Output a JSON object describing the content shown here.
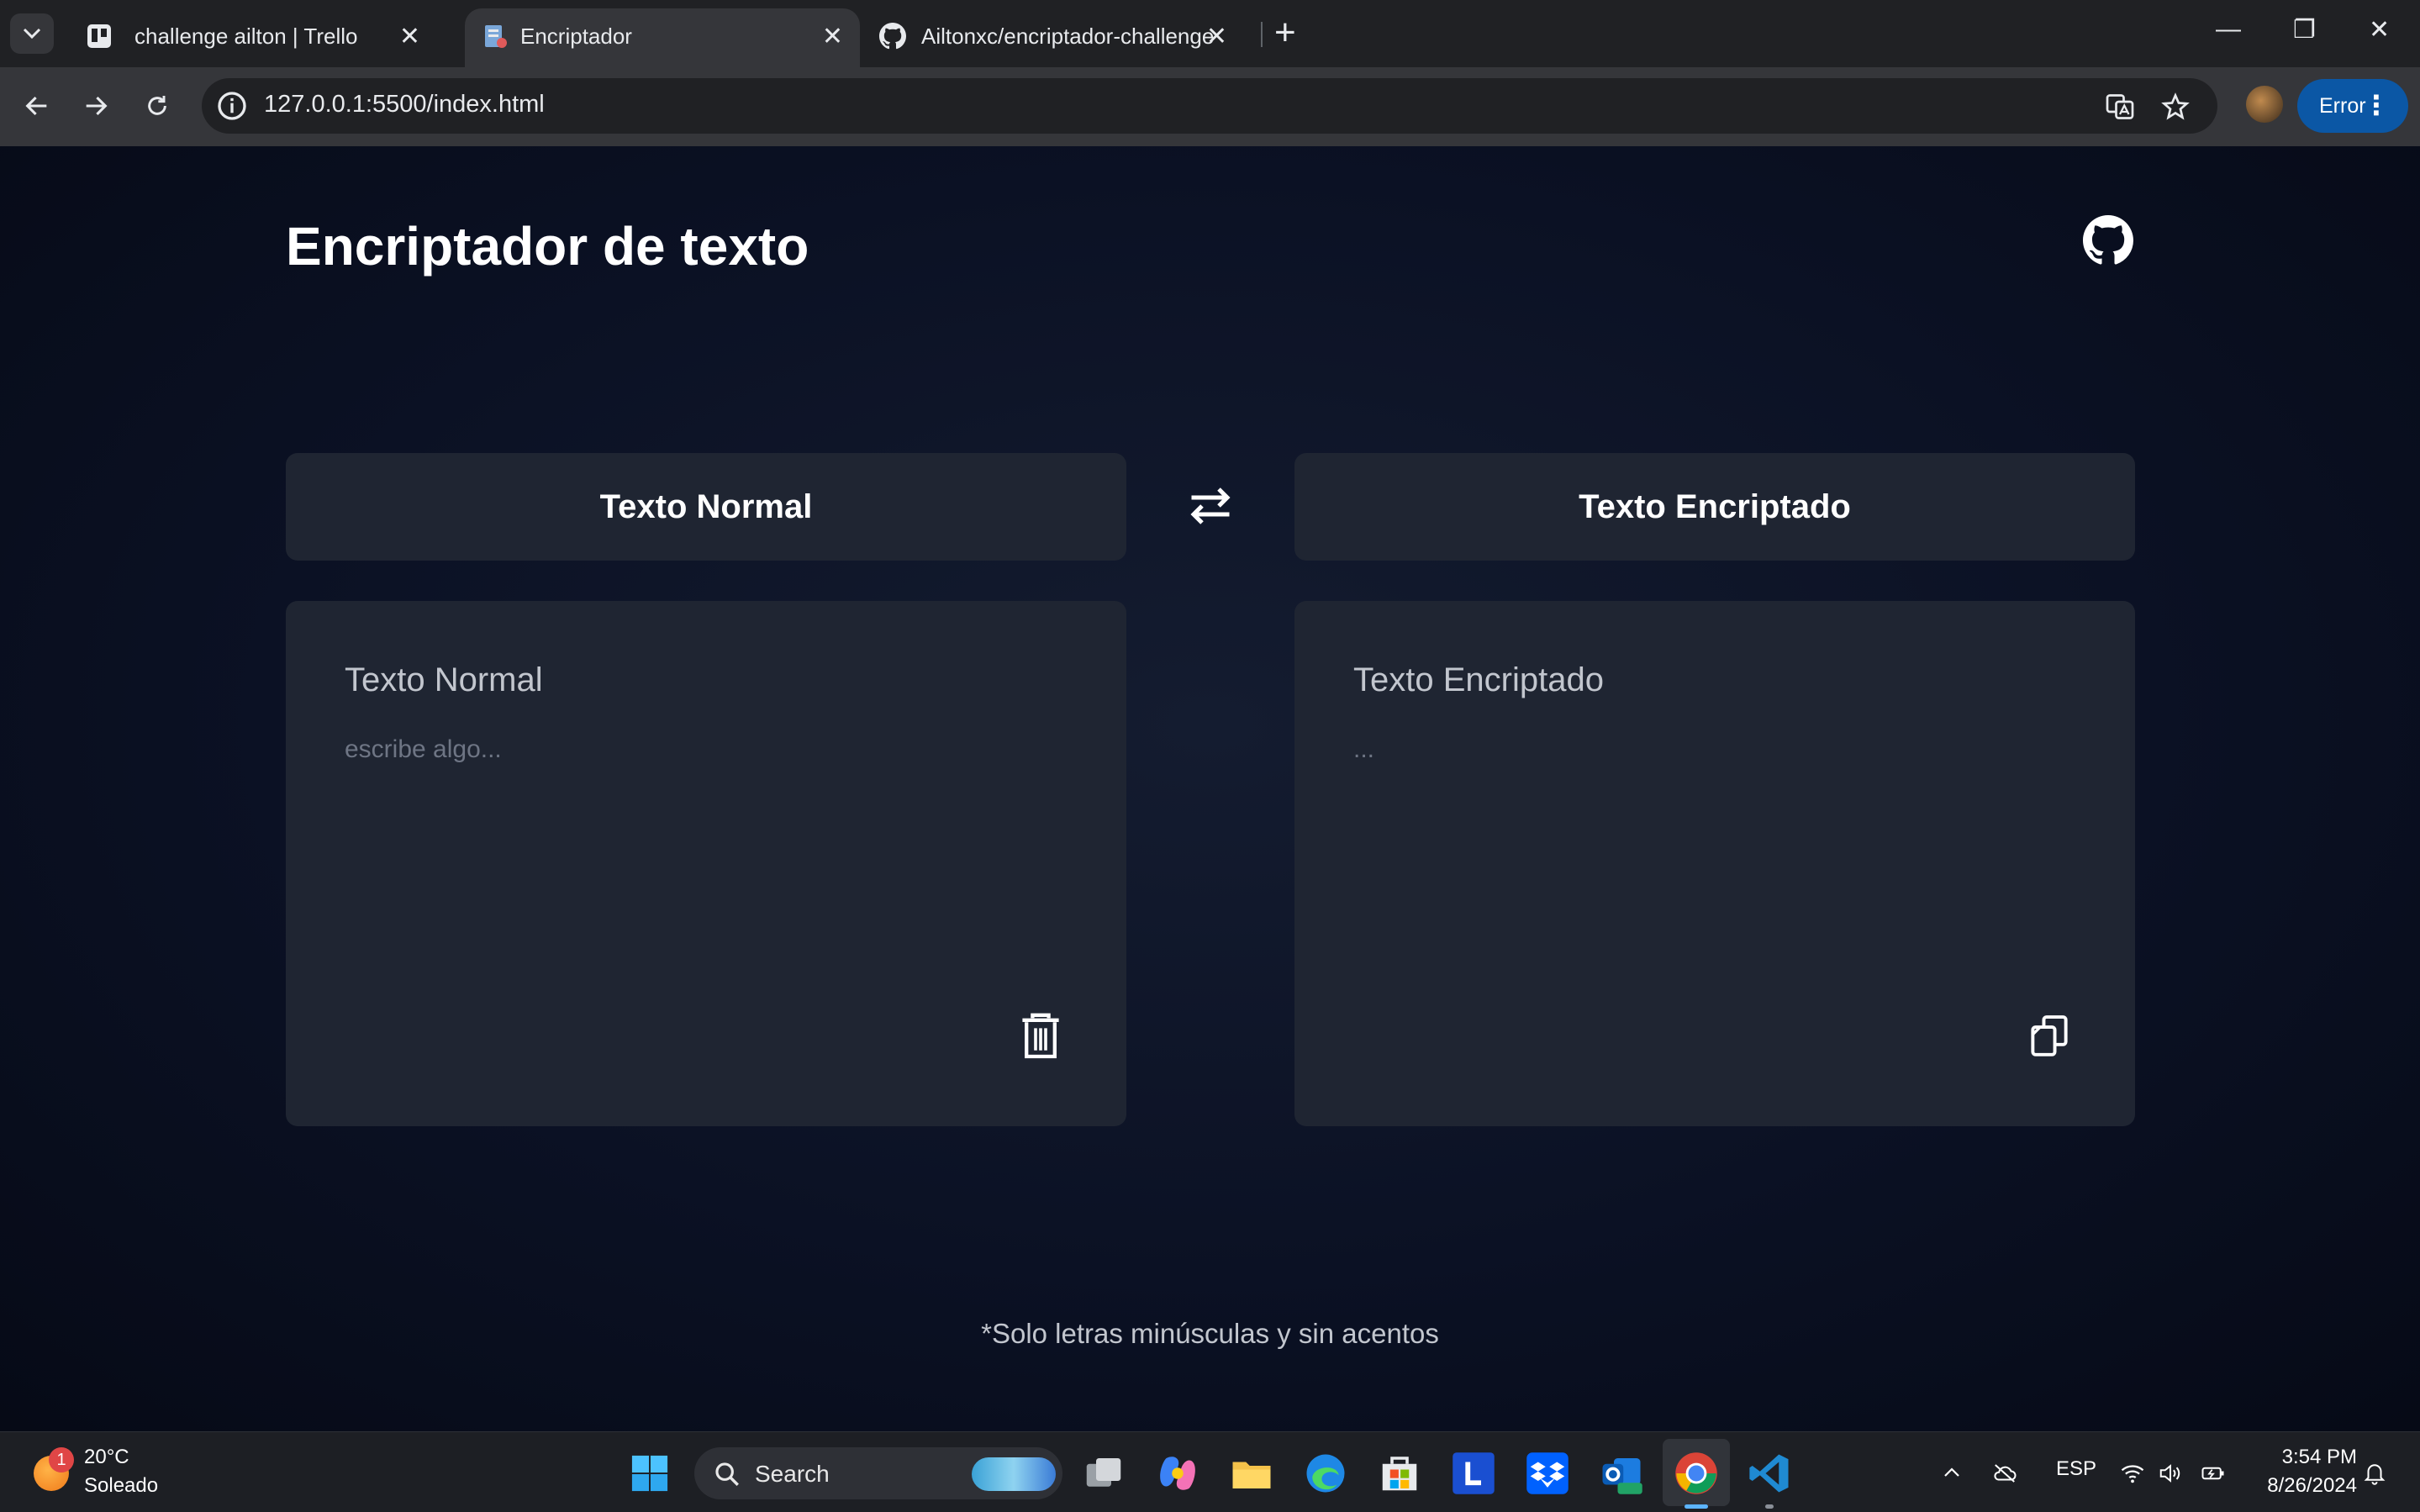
{
  "browser": {
    "tabs": [
      {
        "title": "challenge ailton | Trello",
        "close": "✕",
        "favicon": "trello-icon"
      },
      {
        "title": "Encriptador",
        "close": "✕",
        "favicon": "page-icon"
      },
      {
        "title": "Ailtonxc/encriptador-challenge",
        "close": "✕",
        "favicon": "github-icon"
      }
    ],
    "new_tab": "+",
    "window_controls": {
      "minimize": "—",
      "restore": "❐",
      "close": "✕"
    },
    "url": "127.0.0.1:5500/index.html",
    "profile_status": "Error",
    "menu": "⋮",
    "accent": "#0b57a5"
  },
  "app": {
    "title": "Encriptador de texto",
    "github_icon": "github-icon",
    "source_mode": "Texto Normal",
    "target_mode": "Texto Encriptado",
    "swap_icon": "swap-arrows-icon",
    "input": {
      "label": "Texto Normal",
      "placeholder": "escribe algo..."
    },
    "output": {
      "label": "Texto Encriptado",
      "placeholder": "..."
    },
    "note": "*Solo letras minúsculas y sin acentos"
  },
  "taskbar": {
    "weather": {
      "badge": "1",
      "temp": "20°C",
      "desc": "Soleado"
    },
    "search": "Search",
    "language": "ESP",
    "time": "3:54 PM",
    "date": "8/26/2024"
  }
}
